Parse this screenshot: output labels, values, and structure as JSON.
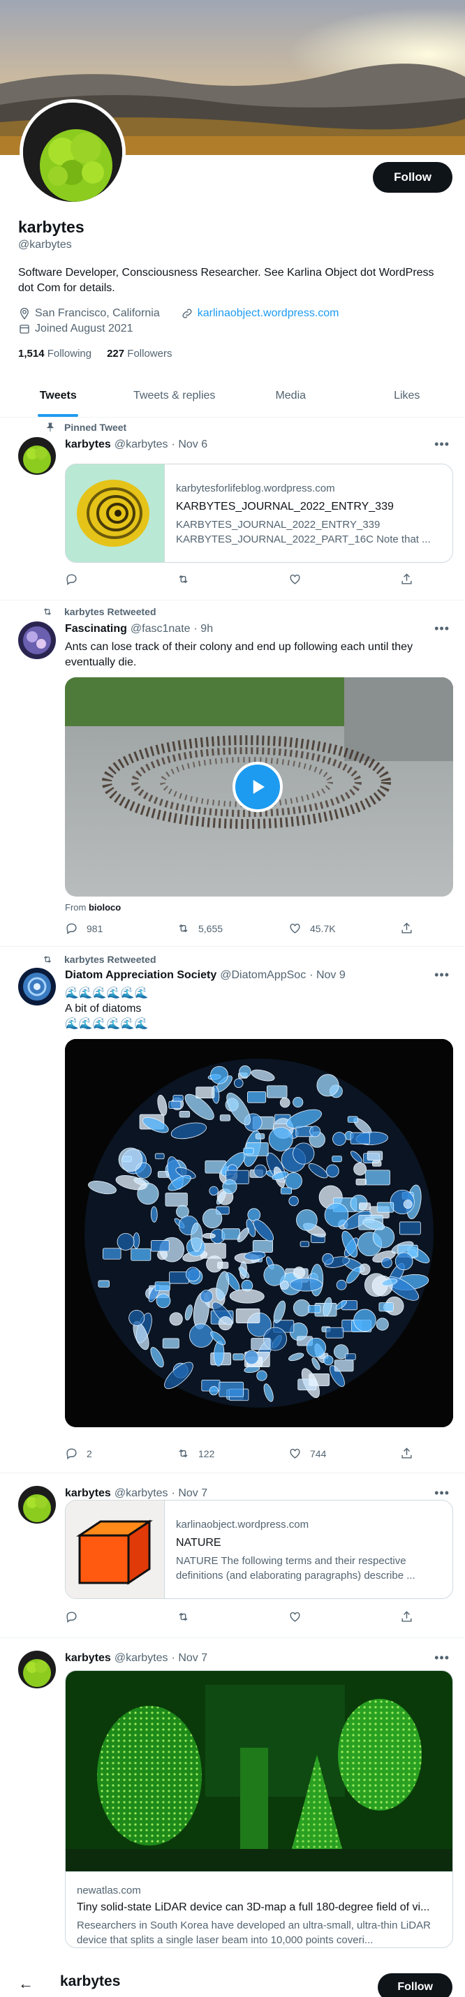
{
  "profile": {
    "name": "karbytes",
    "handle": "@karbytes",
    "follow_label": "Follow",
    "bio": "Software Developer, Consciousness Researcher. See Karlina Object dot WordPress dot Com for details.",
    "location": "San Francisco, California",
    "website": "karlinaobject.wordpress.com",
    "joined": "Joined August 2021",
    "following_count": "1,514",
    "following_label": "Following",
    "followers_count": "227",
    "followers_label": "Followers"
  },
  "tabs": [
    "Tweets",
    "Tweets & replies",
    "Media",
    "Likes"
  ],
  "tweets": [
    {
      "context": "Pinned Tweet",
      "name": "karbytes",
      "handle": "@karbytes",
      "time": "· Nov 6",
      "card": {
        "domain": "karbytesforlifeblog.wordpress.com",
        "title": "KARBYTES_JOURNAL_2022_ENTRY_339",
        "desc": "KARBYTES_JOURNAL_2022_ENTRY_339 KARBYTES_JOURNAL_2022_PART_16C Note that ..."
      }
    },
    {
      "context": "karbytes Retweeted",
      "name": "Fascinating",
      "handle": "@fasc1nate",
      "time": "· 9h",
      "text": "Ants can lose track of their colony and end up following each until they eventually die.",
      "from_label": "From",
      "from_source": "bioloco",
      "replies": "981",
      "retweets": "5,655",
      "likes": "45.7K"
    },
    {
      "context": "karbytes Retweeted",
      "name": "Diatom Appreciation Society",
      "handle": "@DiatomAppSoc",
      "time": "· Nov 9",
      "text_line1": "🌊🌊🌊🌊🌊🌊",
      "text_line2": "A bit of diatoms",
      "text_line3": "🌊🌊🌊🌊🌊🌊",
      "replies": "2",
      "retweets": "122",
      "likes": "744"
    },
    {
      "name": "karbytes",
      "handle": "@karbytes",
      "time": "· Nov 7",
      "card": {
        "domain": "karlinaobject.wordpress.com",
        "title": "NATURE",
        "desc": "NATURE The following terms and their respective definitions (and elaborating paragraphs) describe ..."
      }
    },
    {
      "name": "karbytes",
      "handle": "@karbytes",
      "time": "· Nov 7",
      "card": {
        "domain": "newatlas.com",
        "title": "Tiny solid-state LiDAR device can 3D-map a full 180-degree field of vi...",
        "desc": "Researchers in South Korea have developed an ultra-small, ultra-thin LiDAR device that splits a single laser beam into 10,000 points coveri..."
      }
    }
  ],
  "bottom_bar": {
    "name": "karbytes",
    "follow_label": "Follow"
  },
  "colors": {
    "accent": "#1d9bf0",
    "text": "#0f1419",
    "muted": "#536471",
    "border": "#cfd9de"
  }
}
